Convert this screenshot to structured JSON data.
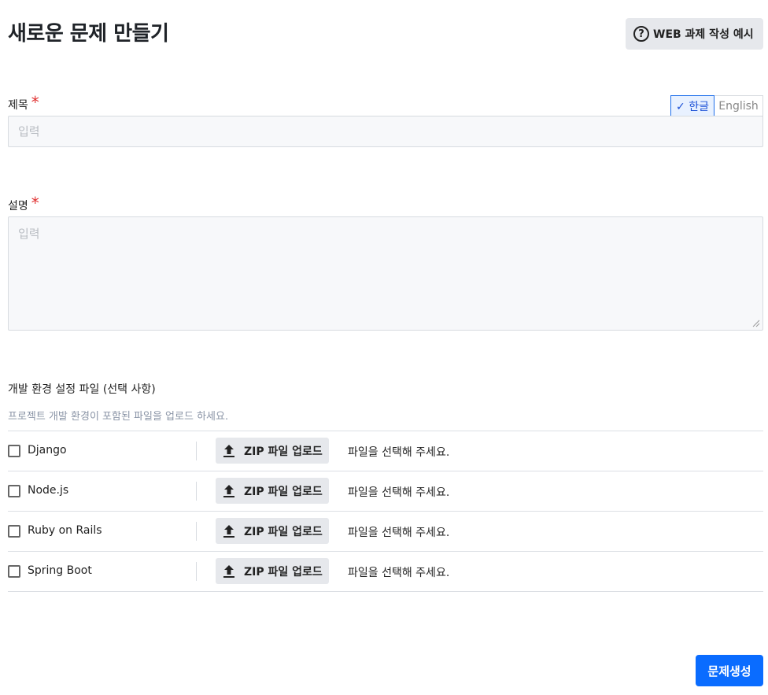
{
  "page": {
    "title": "새로운 문제 만들기",
    "example_button_label": "WEB 과제 작성 예시"
  },
  "title_field": {
    "label": "제목",
    "required_mark": "*",
    "placeholder": "입력",
    "value": ""
  },
  "language_toggle": {
    "options": [
      {
        "label": "✓ 한글",
        "selected": true
      },
      {
        "label": "English",
        "selected": false
      }
    ]
  },
  "description_field": {
    "label": "설명",
    "required_mark": "*",
    "placeholder": "입력",
    "value": ""
  },
  "env_files": {
    "label": "개발 환경 설정 파일 (선택 사항)",
    "hint": "프로젝트 개발 환경이 포함된 파일을 업로드 하세요.",
    "rows": [
      {
        "name": "Django",
        "checked": false,
        "upload_label": "ZIP 파일 업로드",
        "status": "파일을 선택해 주세요."
      },
      {
        "name": "Node.js",
        "checked": false,
        "upload_label": "ZIP 파일 업로드",
        "status": "파일을 선택해 주세요."
      },
      {
        "name": "Ruby on Rails",
        "checked": false,
        "upload_label": "ZIP 파일 업로드",
        "status": "파일을 선택해 주세요."
      },
      {
        "name": "Spring Boot",
        "checked": false,
        "upload_label": "ZIP 파일 업로드",
        "status": "파일을 선택해 주세요."
      }
    ]
  },
  "submit_button_label": "문제생성",
  "colors": {
    "primary": "#0a6cff",
    "required": "#e03131",
    "button_gray": "#e6e8ec",
    "input_bg": "#f7f8fa"
  },
  "icons": {
    "example_button": "help-circle-icon",
    "upload_button": "upload-icon",
    "textarea_corner": "resize-grip-icon"
  }
}
